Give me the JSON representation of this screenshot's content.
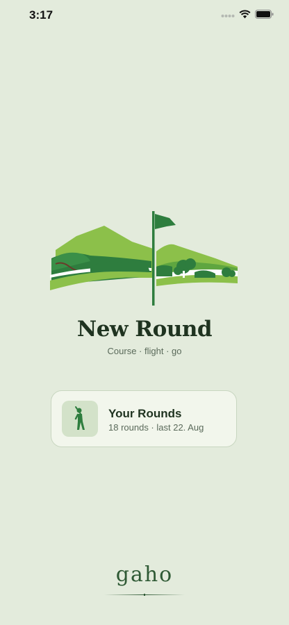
{
  "status_bar": {
    "time": "3:17",
    "icons": [
      "cellular-signal-icon",
      "wifi-icon",
      "battery-icon"
    ]
  },
  "hero": {
    "illustration": "golf-course-flag-illustration",
    "colors": {
      "dark_green": "#2e7d3e",
      "light_green": "#8cc04a",
      "mid_green": "#5fa640"
    }
  },
  "header": {
    "title": "New Round",
    "subtitle": "Course · flight · go"
  },
  "rounds_card": {
    "icon": "golfer-icon",
    "title": "Your Rounds",
    "subtitle": "18 rounds · last 22. Aug"
  },
  "footer": {
    "brand": "gaho"
  }
}
